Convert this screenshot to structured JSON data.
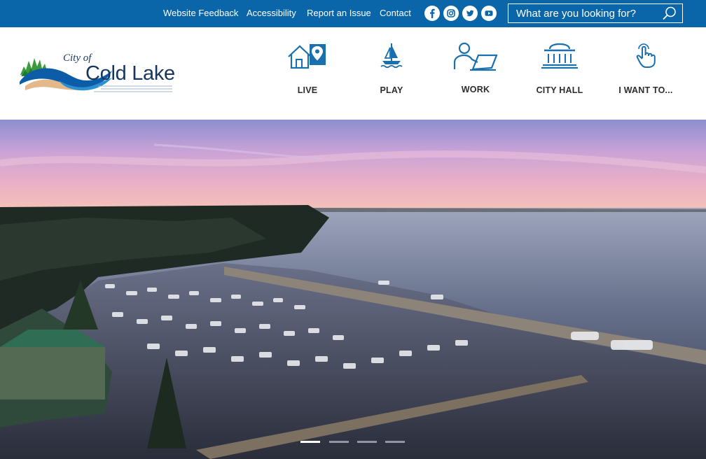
{
  "utility": {
    "links": [
      "Website Feedback",
      "Accessibility",
      "Report an Issue",
      "Contact"
    ],
    "social_icons": [
      "facebook-icon",
      "instagram-icon",
      "twitter-icon",
      "youtube-icon"
    ],
    "search_placeholder": "What are you looking for?",
    "search_icon": "search-icon"
  },
  "brand": {
    "city_prefix": "City of",
    "city_name": "Cold Lake"
  },
  "nav": {
    "items": [
      {
        "label": "LIVE",
        "icon": "house-map-pin-icon"
      },
      {
        "label": "PLAY",
        "icon": "sailboat-icon"
      },
      {
        "label": "WORK",
        "icon": "person-laptop-icon"
      },
      {
        "label": "CITY HALL",
        "icon": "city-hall-building-icon"
      },
      {
        "label": "I WANT TO...",
        "icon": "pointing-hand-icon"
      }
    ]
  },
  "hero": {
    "slide_count": 4,
    "active_slide": 1
  },
  "colors": {
    "utility_bar": "#0a66a8",
    "nav_icon": "#1a6fad",
    "logo_text": "#16365f"
  }
}
